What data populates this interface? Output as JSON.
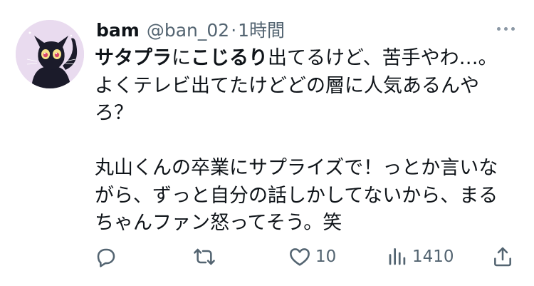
{
  "tweet": {
    "display_name": "bam",
    "handle": "@ban_02",
    "separator": "·",
    "time": "1時間",
    "more_icon": "more-horizontal-icon",
    "text_lines": [
      {
        "segments": [
          {
            "text": "サタプラ",
            "bold": true
          },
          {
            "text": "に",
            "bold": false
          },
          {
            "text": "こじるり",
            "bold": true
          },
          {
            "text": "出てるけど、苦手やわ…。",
            "bold": false
          }
        ]
      },
      {
        "segments": [
          {
            "text": "よくテレビ出てたけどどの層に人気あるんや",
            "bold": false
          }
        ]
      },
      {
        "segments": [
          {
            "text": "ろ？",
            "bold": false
          }
        ]
      },
      {
        "segments": []
      },
      {
        "segments": [
          {
            "text": "丸山くんの卒業にサプライズで！っとか言いな",
            "bold": false
          }
        ]
      },
      {
        "segments": [
          {
            "text": "がら、ずっと自分の話しかしてないから、まる",
            "bold": false
          }
        ]
      },
      {
        "segments": [
          {
            "text": "ちゃんファン怒ってそう。笑",
            "bold": false
          }
        ]
      }
    ]
  },
  "actions": {
    "reply": {
      "icon": "reply-icon",
      "count": ""
    },
    "retweet": {
      "icon": "retweet-icon",
      "count": ""
    },
    "like": {
      "icon": "heart-icon",
      "count": "10"
    },
    "views": {
      "icon": "views-chart-icon",
      "count": "1410"
    },
    "share": {
      "icon": "share-icon",
      "count": ""
    }
  },
  "colors": {
    "text": "#0f1419",
    "secondary": "#536471",
    "background": "#ffffff"
  }
}
